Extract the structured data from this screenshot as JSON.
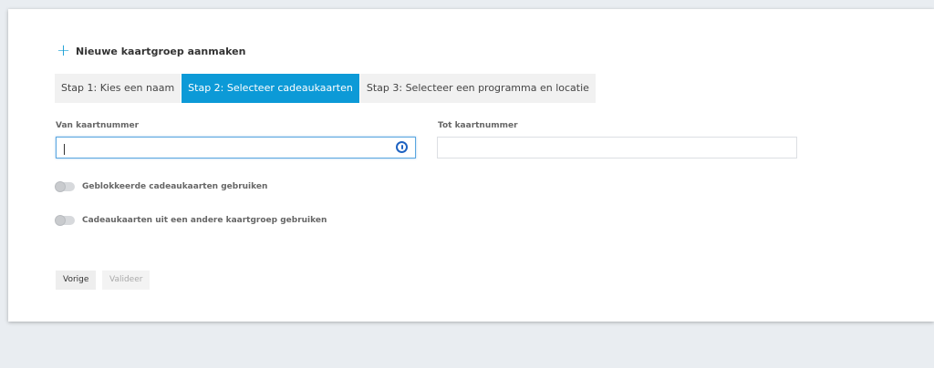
{
  "header": {
    "icon": "plus-icon",
    "title": "Nieuwe kaartgroep aanmaken",
    "accent": "#0f9bd4"
  },
  "tabs": [
    {
      "label": "Stap 1: Kies een naam",
      "active": false
    },
    {
      "label": "Stap 2: Selecteer cadeaukaarten",
      "active": true
    },
    {
      "label": "Stap 3: Selecteer een programma en locatie",
      "active": false
    }
  ],
  "form": {
    "from": {
      "label": "Van kaartnummer",
      "value": "",
      "focused": true
    },
    "to": {
      "label": "Tot kaartnummer",
      "value": ""
    },
    "toggles": [
      {
        "label": "Geblokkeerde cadeaukaarten gebruiken",
        "on": false
      },
      {
        "label": "Cadeaukaarten uit een andere kaartgroep gebruiken",
        "on": false
      }
    ]
  },
  "buttons": {
    "previous": "Vorige",
    "validate": "Valideer"
  },
  "colors": {
    "active_tab": "#0c9ad7",
    "page_bg": "#e9edf1"
  }
}
